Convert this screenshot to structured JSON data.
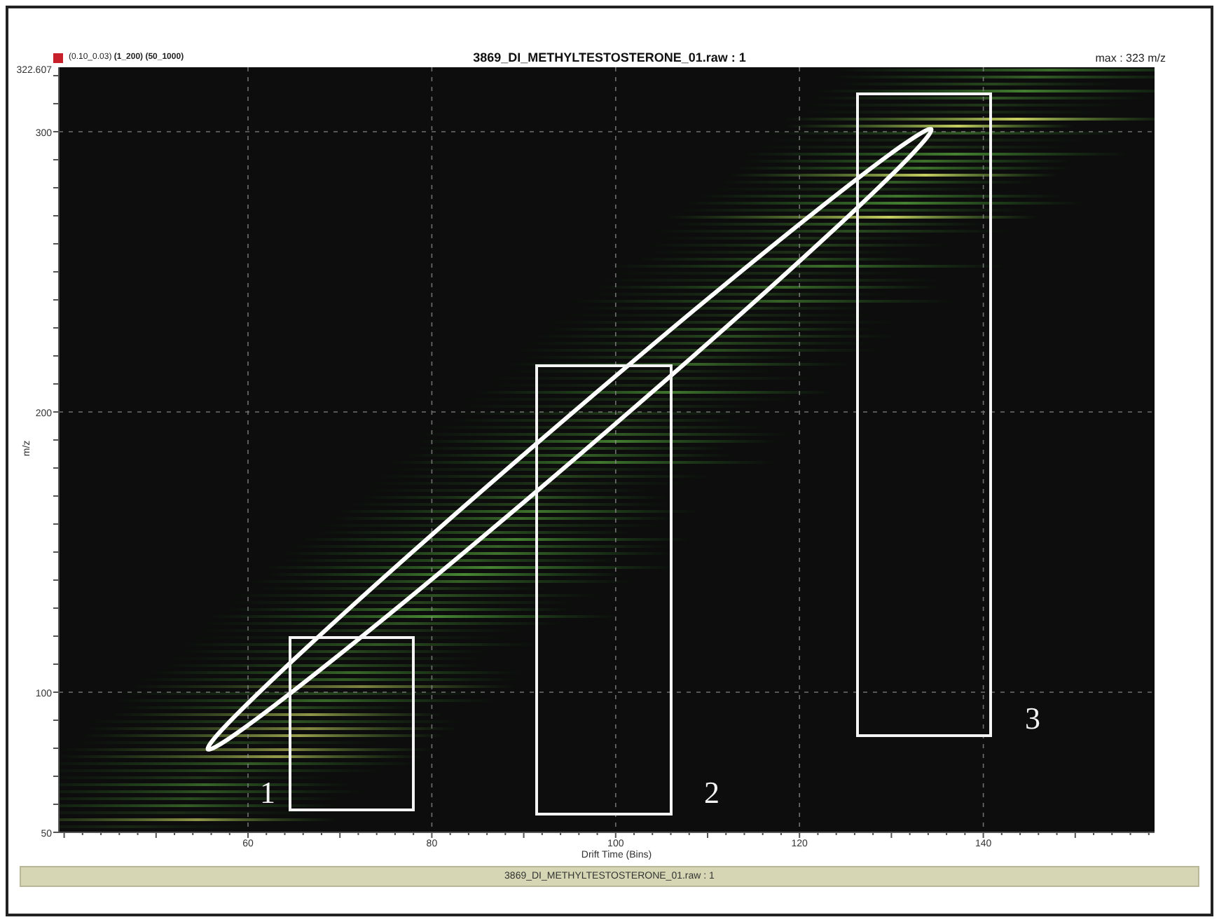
{
  "legend": {
    "text": "(0.10_0.03) **(1_200) (50_1000)**"
  },
  "title": "3869_DI_METHYLTESTOSTERONE_01.raw : 1",
  "max_label": "max : 323 m/z",
  "plot": {
    "ylabel": "m/z",
    "xlabel": "Drift Time (Bins)",
    "yticks": [
      "322.607",
      "300",
      "200",
      "100",
      "50"
    ],
    "xticks": [
      "60",
      "80",
      "100",
      "120",
      "140"
    ],
    "annotations": [
      {
        "kind": "ellipse"
      },
      {
        "kind": "box",
        "label": "1"
      },
      {
        "kind": "box",
        "label": "2"
      },
      {
        "kind": "box",
        "label": "3"
      }
    ]
  },
  "status_bar": "3869_DI_METHYLTESTOSTERONE_01.raw : 1"
}
